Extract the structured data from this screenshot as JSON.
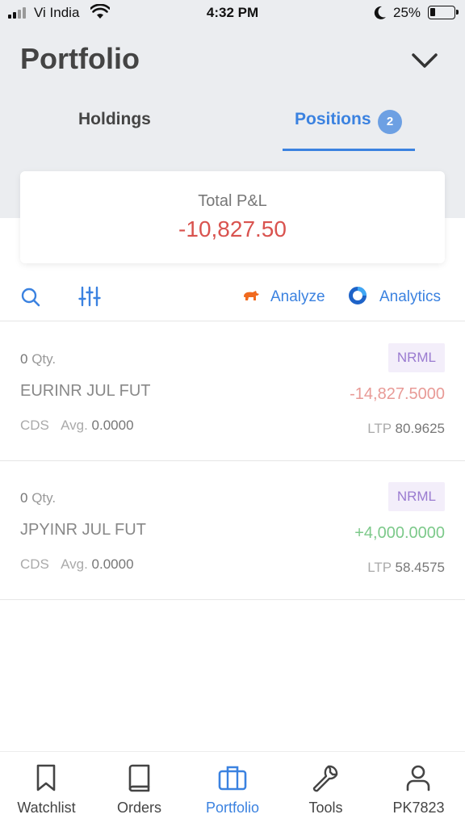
{
  "status_bar": {
    "carrier": "Vi India",
    "time": "4:32 PM",
    "battery_percent": "25%",
    "battery_level": 0.25
  },
  "header": {
    "title": "Portfolio",
    "collapse_icon": "chevron-down-icon"
  },
  "tabs": [
    {
      "label": "Holdings",
      "active": false
    },
    {
      "label": "Positions",
      "badge": "2",
      "active": true
    }
  ],
  "summary": {
    "label": "Total P&L",
    "value": "-10,827.50"
  },
  "toolbar": {
    "search_icon": "search-icon",
    "filter_icon": "sliders-icon",
    "analyze_label": "Analyze",
    "analytics_label": "Analytics"
  },
  "positions": [
    {
      "qty": "0",
      "qty_label": "Qty.",
      "symbol": "EURINR JUL FUT",
      "exchange": "CDS",
      "avg_label": "Avg.",
      "avg": "0.0000",
      "product": "NRML",
      "pnl": "-14,827.5000",
      "ltp_label": "LTP",
      "ltp": "80.9625"
    },
    {
      "qty": "0",
      "qty_label": "Qty.",
      "symbol": "JPYINR JUL FUT",
      "exchange": "CDS",
      "avg_label": "Avg.",
      "avg": "0.0000",
      "product": "NRML",
      "pnl": "+4,000.0000",
      "ltp_label": "LTP",
      "ltp": "58.4575"
    }
  ],
  "colors": {
    "accent": "#3b82e0",
    "loss": "#d9534f",
    "gain": "#7cc98a",
    "product_badge_bg": "#f3eefa",
    "product_badge_text": "#9a7bd0"
  },
  "bottom_nav": [
    {
      "label": "Watchlist",
      "icon": "bookmark-icon",
      "active": false
    },
    {
      "label": "Orders",
      "icon": "book-icon",
      "active": false
    },
    {
      "label": "Portfolio",
      "icon": "briefcase-icon",
      "active": true
    },
    {
      "label": "Tools",
      "icon": "wrench-icon",
      "active": false
    },
    {
      "label": "PK7823",
      "icon": "user-icon",
      "active": false
    }
  ]
}
